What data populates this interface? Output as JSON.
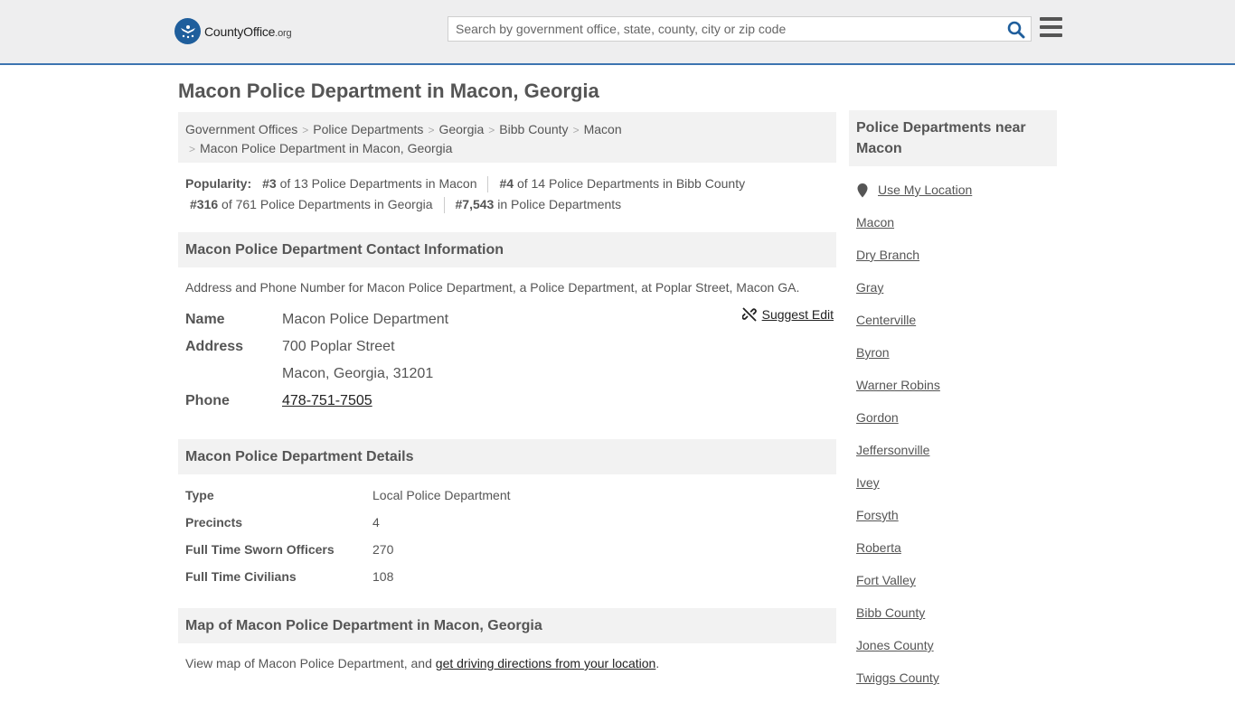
{
  "header": {
    "logo_text": "CountyOffice",
    "logo_suffix": ".org",
    "search_placeholder": "Search by government office, state, county, city or zip code"
  },
  "page_title": "Macon Police Department in Macon, Georgia",
  "breadcrumb": [
    "Government Offices",
    "Police Departments",
    "Georgia",
    "Bibb County",
    "Macon",
    "Macon Police Department in Macon, Georgia"
  ],
  "popularity": {
    "label": "Popularity:",
    "items": [
      {
        "rank": "#3",
        "text": "of 13 Police Departments in Macon"
      },
      {
        "rank": "#4",
        "text": "of 14 Police Departments in Bibb County"
      },
      {
        "rank": "#316",
        "text": "of 761 Police Departments in Georgia"
      },
      {
        "rank": "#7,543",
        "text": "in Police Departments"
      }
    ]
  },
  "contact": {
    "heading": "Macon Police Department Contact Information",
    "description": "Address and Phone Number for Macon Police Department, a Police Department, at Poplar Street, Macon GA.",
    "name_label": "Name",
    "name": "Macon Police Department",
    "address_label": "Address",
    "address_line1": "700 Poplar Street",
    "address_line2": "Macon, Georgia, 31201",
    "phone_label": "Phone",
    "phone": "478-751-7505",
    "suggest_edit": "Suggest Edit"
  },
  "details": {
    "heading": "Macon Police Department Details",
    "rows": [
      {
        "label": "Type",
        "value": "Local Police Department"
      },
      {
        "label": "Precincts",
        "value": "4"
      },
      {
        "label": "Full Time Sworn Officers",
        "value": "270"
      },
      {
        "label": "Full Time Civilians",
        "value": "108"
      }
    ]
  },
  "map": {
    "heading": "Map of Macon Police Department in Macon, Georgia",
    "description_prefix": "View map of Macon Police Department, and ",
    "link_text": "get driving directions from your location",
    "description_suffix": "."
  },
  "sidebar": {
    "heading": "Police Departments near Macon",
    "use_location": "Use My Location",
    "items": [
      "Macon",
      "Dry Branch",
      "Gray",
      "Centerville",
      "Byron",
      "Warner Robins",
      "Gordon",
      "Jeffersonville",
      "Ivey",
      "Forsyth",
      "Roberta",
      "Fort Valley",
      "Bibb County",
      "Jones County",
      "Twiggs County"
    ]
  }
}
